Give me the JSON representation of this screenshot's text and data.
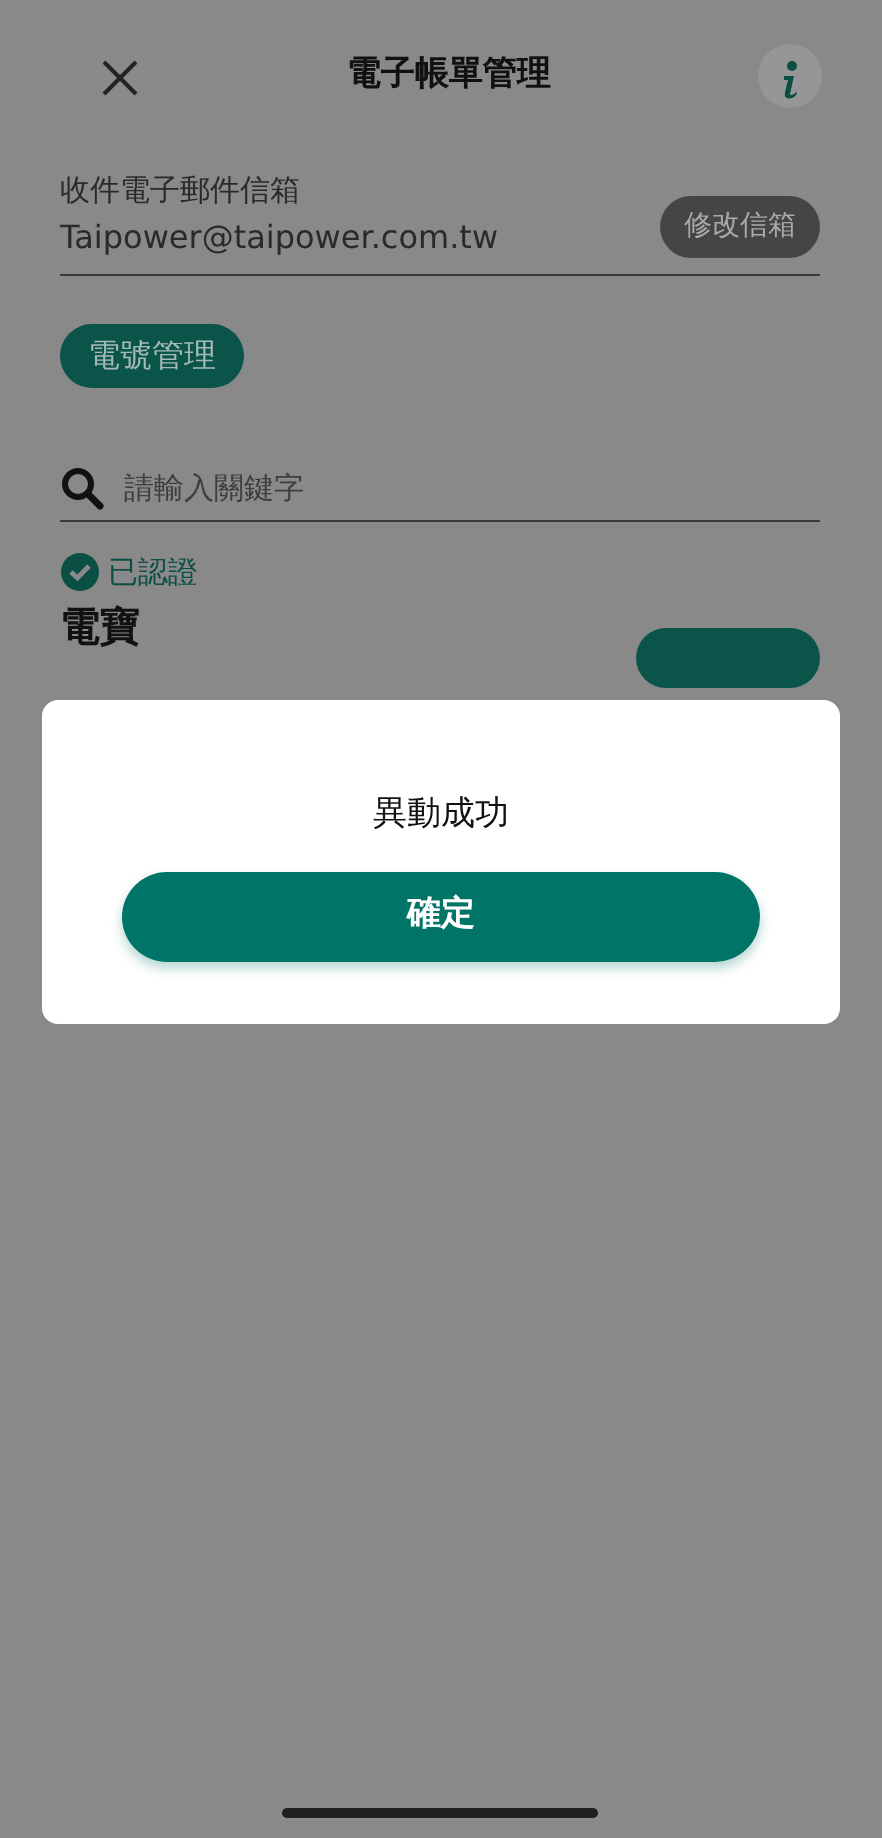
{
  "header": {
    "title": "電子帳單管理"
  },
  "email": {
    "label": "收件電子郵件信箱",
    "value": "Taipower@taipower.com.tw",
    "button": "修改信箱"
  },
  "manage_button": "電號管理",
  "search": {
    "placeholder": "請輸入關鍵字"
  },
  "status": "已認證",
  "account": {
    "name": "電寶"
  },
  "dialog": {
    "message": "異動成功",
    "button": "確定"
  }
}
